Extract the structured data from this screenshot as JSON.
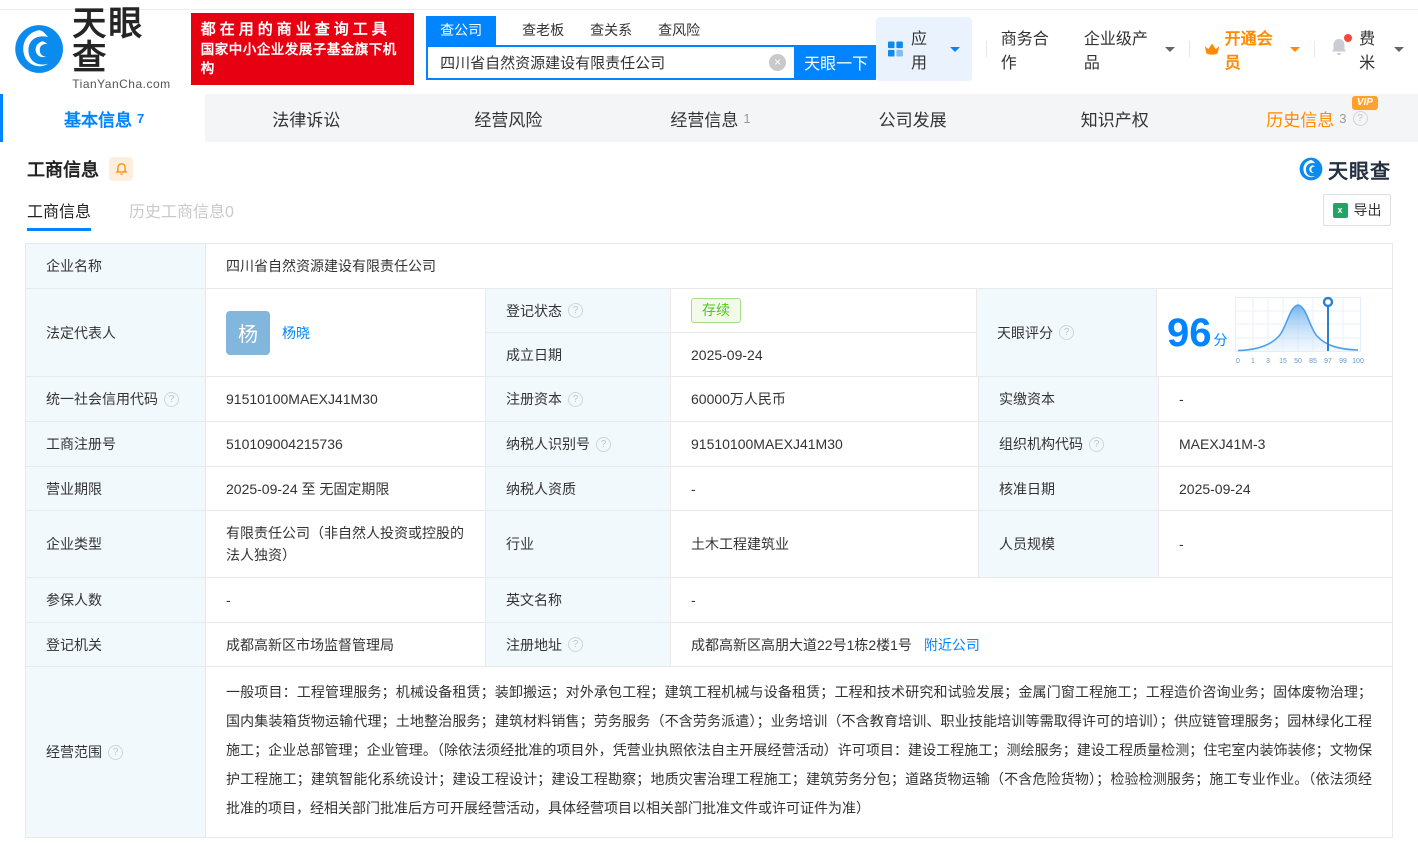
{
  "colors": {
    "accent": "#0084ff",
    "banner_red": "#e60012",
    "vip_orange": "#ff8a00",
    "status_green": "#52c41a"
  },
  "brand": {
    "logo_cn": "天眼查",
    "logo_en": "TianYanCha.com",
    "slogan_line1": "都在用的商业查询工具",
    "slogan_line2": "国家中小企业发展子基金旗下机构"
  },
  "search": {
    "tabs": [
      {
        "label": "查公司"
      },
      {
        "label": "查老板"
      },
      {
        "label": "查关系"
      },
      {
        "label": "查风险"
      }
    ],
    "value": "四川省自然资源建设有限责任公司",
    "button": "天眼一下"
  },
  "topnav": {
    "apps": "应用",
    "cooperation": "商务合作",
    "enterprise": "企业级产品",
    "vip": "开通会员",
    "user": "费米"
  },
  "main_tabs": [
    {
      "label": "基本信息",
      "count": "7"
    },
    {
      "label": "法律诉讼"
    },
    {
      "label": "经营风险"
    },
    {
      "label": "经营信息",
      "count": "1"
    },
    {
      "label": "公司发展"
    },
    {
      "label": "知识产权"
    },
    {
      "label": "历史信息",
      "count": "3",
      "vip_badge": "VIP"
    }
  ],
  "section": {
    "title": "工商信息",
    "watermark": "天眼查"
  },
  "sub_tabs": {
    "current": "工商信息",
    "history": "历史工商信息0"
  },
  "export_label": "导出",
  "info": {
    "company_name_label": "企业名称",
    "company_name": "四川省自然资源建设有限责任公司",
    "legal_rep_label": "法定代表人",
    "legal_rep_avatar": "杨",
    "legal_rep": "杨晓",
    "reg_status_label": "登记状态",
    "reg_status": "存续",
    "est_date_label": "成立日期",
    "est_date": "2025-09-24",
    "score_label": "天眼评分",
    "score": "96",
    "score_unit": "分",
    "uscc_label": "统一社会信用代码",
    "uscc": "91510100MAEXJ41M30",
    "reg_capital_label": "注册资本",
    "reg_capital": "60000万人民币",
    "paid_capital_label": "实缴资本",
    "paid_capital": "-",
    "reg_no_label": "工商注册号",
    "reg_no": "510109004215736",
    "taxpayer_id_label": "纳税人识别号",
    "taxpayer_id": "91510100MAEXJ41M30",
    "org_code_label": "组织机构代码",
    "org_code": "MAEXJ41M-3",
    "term_label": "营业期限",
    "term": "2025-09-24 至 无固定期限",
    "taxpayer_quali_label": "纳税人资质",
    "taxpayer_quali": "-",
    "approval_date_label": "核准日期",
    "approval_date": "2025-09-24",
    "company_type_label": "企业类型",
    "company_type": "有限责任公司（非自然人投资或控股的法人独资）",
    "industry_label": "行业",
    "industry": "土木工程建筑业",
    "staff_label": "人员规模",
    "staff": "-",
    "insured_label": "参保人数",
    "insured": "-",
    "en_name_label": "英文名称",
    "en_name": "-",
    "reg_authority_label": "登记机关",
    "reg_authority": "成都高新区市场监督管理局",
    "address_label": "注册地址",
    "address": "成都高新区高朋大道22号1栋2楼1号",
    "nearby": "附近公司",
    "scope_label": "经营范围",
    "scope": "一般项目：工程管理服务；机械设备租赁；装卸搬运；对外承包工程；建筑工程机械与设备租赁；工程和技术研究和试验发展；金属门窗工程施工；工程造价咨询业务；固体废物治理；国内集装箱货物运输代理；土地整治服务；建筑材料销售；劳务服务（不含劳务派遣）；业务培训（不含教育培训、职业技能培训等需取得许可的培训）；供应链管理服务；园林绿化工程施工；企业总部管理；企业管理。（除依法须经批准的项目外，凭营业执照依法自主开展经营活动）许可项目：建设工程施工；测绘服务；建设工程质量检测；住宅室内装饰装修；文物保护工程施工；建筑智能化系统设计；建设工程设计；建设工程勘察；地质灾害治理工程施工；建筑劳务分包；道路货物运输（不含危险货物）；检验检测服务；施工专业作业。（依法须经批准的项目，经相关部门批准后方可开展经营活动，具体经营项目以相关部门批准文件或许可证件为准）"
  },
  "score_chart": {
    "type": "area",
    "description": "score distribution bell curve with marker at company score",
    "x_ticks": [
      "0",
      "1",
      "3",
      "15",
      "50",
      "85",
      "97",
      "99",
      "100"
    ],
    "marker_tick": "97"
  }
}
